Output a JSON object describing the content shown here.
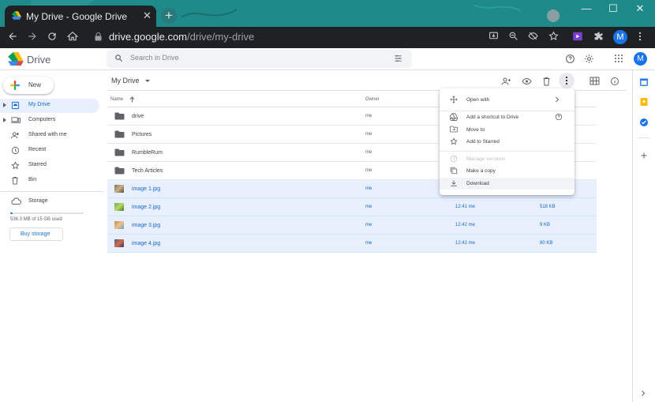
{
  "browser": {
    "tab_title": "My Drive - Google Drive",
    "tab_close": "✕",
    "new_tab": "+",
    "url_host": "drive.google.com",
    "url_path": "/drive/my-drive",
    "profile_initial": "M",
    "window_controls": {
      "minimize": "—",
      "maximize": "☐",
      "close": "✕"
    },
    "theme_color": "#1f8a8a"
  },
  "drive": {
    "app_name": "Drive",
    "search_placeholder": "Search in Drive",
    "profile_initial": "M",
    "new_label": "New",
    "nav": [
      {
        "label": "My Drive",
        "icon": "my-drive-icon",
        "active": true
      },
      {
        "label": "Computers",
        "icon": "computer-icon",
        "active": false
      },
      {
        "label": "Shared with me",
        "icon": "people-icon",
        "active": false
      },
      {
        "label": "Recent",
        "icon": "clock-icon",
        "active": false
      },
      {
        "label": "Starred",
        "icon": "star-icon",
        "active": false
      },
      {
        "label": "Bin",
        "icon": "bin-icon",
        "active": false
      }
    ],
    "storage": {
      "label": "Storage",
      "usage_text": "536.3 MB of 15 GB used",
      "used_fraction": 0.035,
      "buy_label": "Buy storage"
    },
    "breadcrumb": "My Drive",
    "columns": {
      "name": "Name",
      "owner": "Owner"
    },
    "files": [
      {
        "name": "drive",
        "type": "folder",
        "owner": "me",
        "modified": "",
        "size": "",
        "selected": false
      },
      {
        "name": "Pictures",
        "type": "folder",
        "owner": "me",
        "modified": "",
        "size": "",
        "selected": false
      },
      {
        "name": "RumbleRum",
        "type": "folder",
        "owner": "me",
        "modified": "",
        "size": "",
        "selected": false
      },
      {
        "name": "Tech Articles",
        "type": "folder",
        "owner": "me",
        "modified": "",
        "size": "",
        "selected": false
      },
      {
        "name": "image 1.jpg",
        "type": "image",
        "owner": "me",
        "modified": "",
        "size": "",
        "selected": true
      },
      {
        "name": "image 2.jpg",
        "type": "image",
        "owner": "me",
        "modified": "12:41 me",
        "size": "518 KB",
        "selected": true
      },
      {
        "name": "image 3.jpg",
        "type": "image",
        "owner": "me",
        "modified": "12:42 me",
        "size": "9 KB",
        "selected": true
      },
      {
        "name": "image 4.jpg",
        "type": "image",
        "owner": "me",
        "modified": "12:42 me",
        "size": "80 KB",
        "selected": true
      }
    ],
    "context_menu": [
      {
        "label": "Open with",
        "icon": "move-icon",
        "submenu": true,
        "disabled": false
      },
      {
        "label": "Add a shortcut to Drive",
        "icon": "add-shortcut-icon",
        "help": true,
        "disabled": false
      },
      {
        "label": "Move to",
        "icon": "folder-move-icon",
        "disabled": false
      },
      {
        "label": "Add to Starred",
        "icon": "star-icon",
        "disabled": false
      },
      {
        "label": "Manage versions",
        "icon": "history-icon",
        "disabled": true
      },
      {
        "label": "Make a copy",
        "icon": "copy-icon",
        "disabled": false
      },
      {
        "label": "Download",
        "icon": "download-icon",
        "disabled": false,
        "hover": true
      }
    ],
    "accent_color": "#1a73e8",
    "selection_color": "#e8f0fe"
  }
}
